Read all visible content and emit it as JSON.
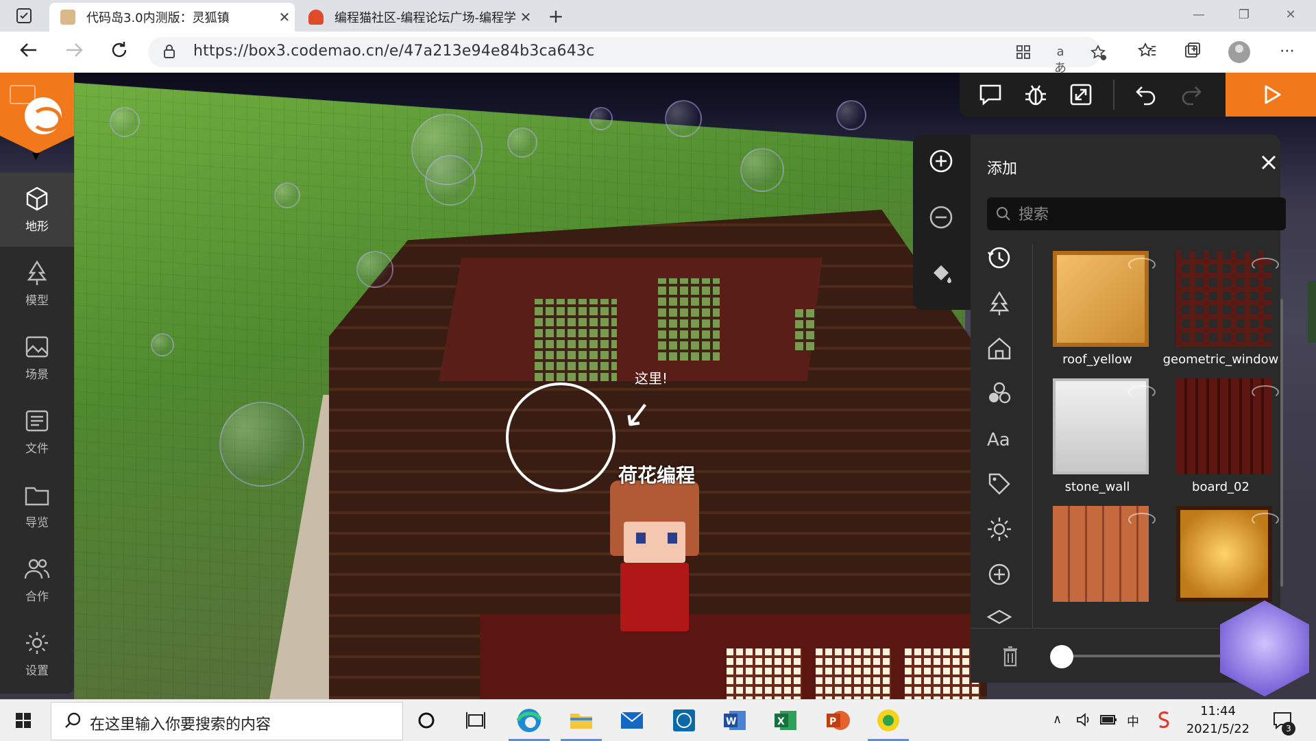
{
  "browser": {
    "tabs": [
      {
        "title": "代码岛3.0内测版：灵狐镇",
        "active": true
      },
      {
        "title": "编程猫社区-编程论坛广场-编程学",
        "active": false
      }
    ],
    "url": "https://box3.codemao.cn/e/47a213e94e84b3ca643c",
    "translate_label": "aあ"
  },
  "sidebar": {
    "items": [
      {
        "label": "地形",
        "icon": "cube-icon",
        "active": true
      },
      {
        "label": "模型",
        "icon": "tree-icon",
        "active": false
      },
      {
        "label": "场景",
        "icon": "image-icon",
        "active": false
      },
      {
        "label": "文件",
        "icon": "file-icon",
        "active": false
      },
      {
        "label": "导览",
        "icon": "folder-icon",
        "active": false
      },
      {
        "label": "合作",
        "icon": "users-icon",
        "active": false
      },
      {
        "label": "设置",
        "icon": "gear-icon",
        "active": false
      }
    ]
  },
  "scene": {
    "hint_label": "这里!",
    "arrow_glyph": "↙",
    "nametag": "荷花编程"
  },
  "add_panel": {
    "title": "添加",
    "search_placeholder": "搜索",
    "tiles": [
      {
        "name": "roof_yellow",
        "color": "#e8a94a"
      },
      {
        "name": "geometric_window",
        "color": "#5a1b14"
      },
      {
        "name": "stone_wall",
        "color": "#d8d8d8"
      },
      {
        "name": "board_02",
        "color": "#5c1510"
      },
      {
        "name": "",
        "color": "#b8623a"
      },
      {
        "name": "",
        "color": "#f0b040"
      }
    ]
  },
  "taskbar": {
    "search_text": "在这里输入你要搜索的内容",
    "time": "11:44",
    "date": "2021/5/22",
    "ime_label": "中",
    "notification_count": "3"
  },
  "colors": {
    "accent": "#f2781c",
    "panel_bg": "#2a2a2a",
    "toolbar_bg": "#1e1e1e"
  }
}
